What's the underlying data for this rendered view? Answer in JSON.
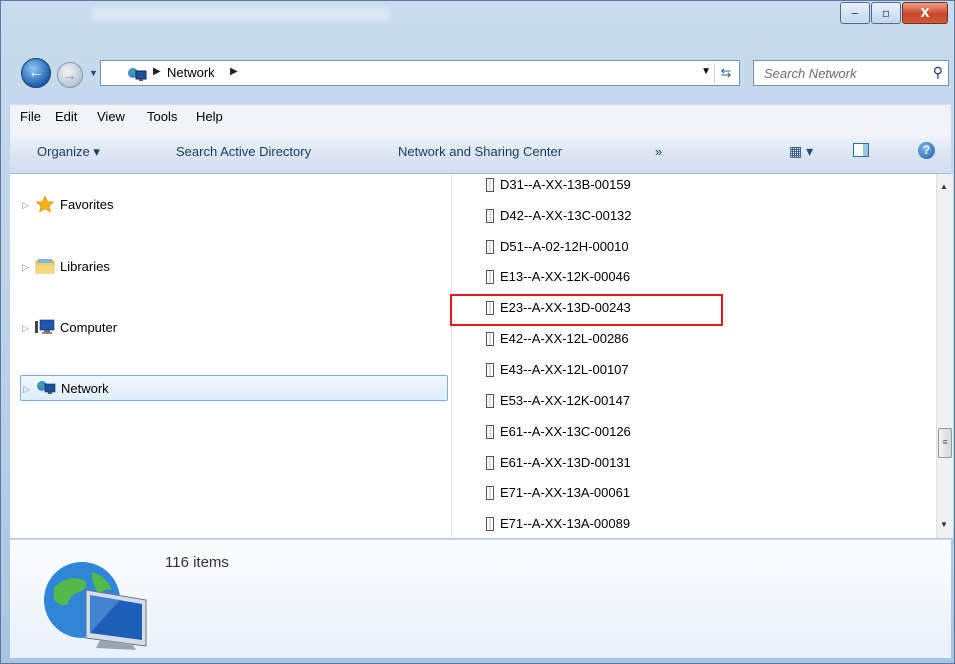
{
  "window": {
    "controls": {
      "minimize": "‒",
      "maximize": "▫",
      "close": "X"
    }
  },
  "address_bar": {
    "crumbs": [
      "Network"
    ],
    "search_placeholder": "Search Network"
  },
  "menu": [
    "File",
    "Edit",
    "View",
    "Tools",
    "Help"
  ],
  "toolbar": {
    "organize_label": "Organize ▾",
    "search_ad_label": "Search Active Directory",
    "nsc_label": "Network and Sharing Center",
    "more_label": "»",
    "views_label": "▾",
    "help_label": "?"
  },
  "nav_pane": {
    "items": [
      {
        "label": "Favorites",
        "icon": "star-icon"
      },
      {
        "label": "Libraries",
        "icon": "library-icon"
      },
      {
        "label": "Computer",
        "icon": "computer-icon"
      },
      {
        "label": "Network",
        "icon": "network-icon",
        "selected": true
      }
    ]
  },
  "files": [
    "D31--A-XX-13B-00159",
    "D42--A-XX-13C-00132",
    "D51--A-02-12H-00010",
    "E13--A-XX-12K-00046",
    "E23--A-XX-13D-00243",
    "E42--A-XX-12L-00286",
    "E43--A-XX-12L-00107",
    "E53--A-XX-12K-00147",
    "E61--A-XX-13C-00126",
    "E61--A-XX-13D-00131",
    "E71--A-XX-13A-00061",
    "E71--A-XX-13A-00089"
  ],
  "highlighted_file": "E23--A-XX-13D-00243",
  "details": {
    "count_text": "116 items"
  },
  "colors": {
    "highlight": "#e01b1b",
    "selection": "#84acdd"
  }
}
